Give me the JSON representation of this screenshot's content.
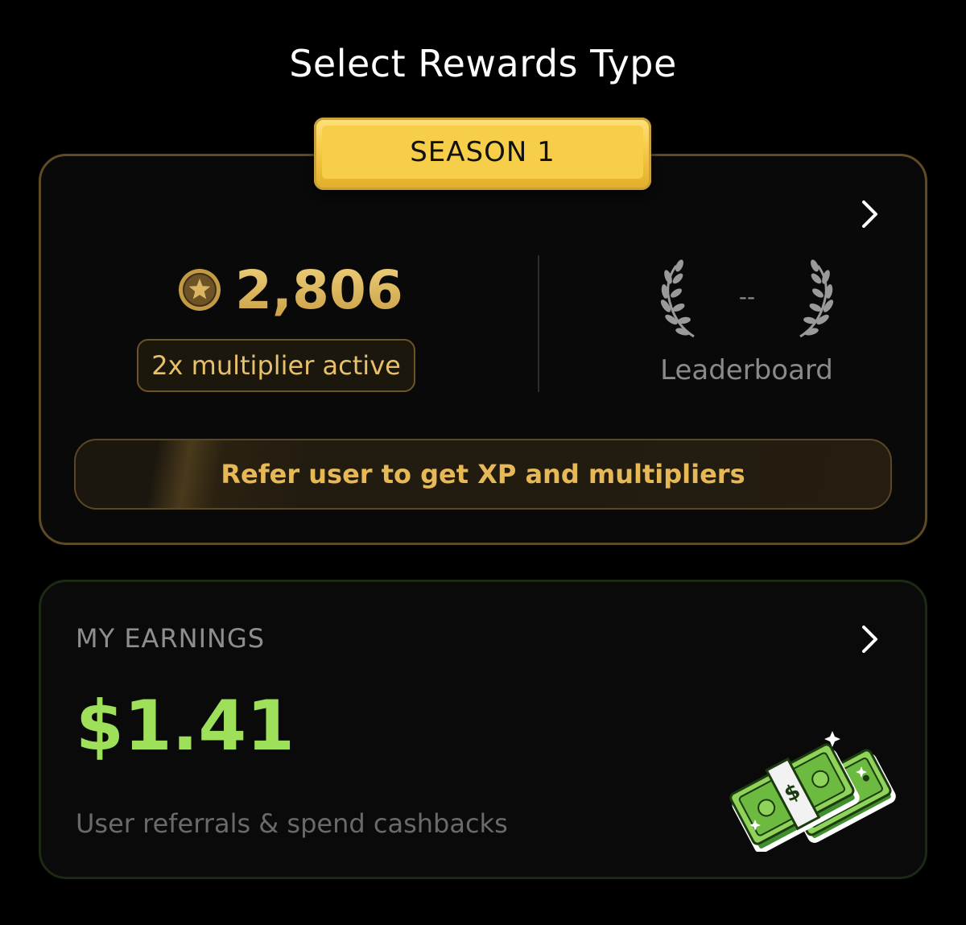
{
  "header": {
    "title": "Select Rewards Type"
  },
  "season_card": {
    "badge_label": "SEASON 1",
    "xp_value": "2,806",
    "multiplier_label": "2x multiplier active",
    "rank_value": "--",
    "leaderboard_label": "Leaderboard",
    "refer_button_label": "Refer user to get XP and multipliers"
  },
  "earnings_card": {
    "heading": "MY EARNINGS",
    "amount": "$1.41",
    "caption": "User referrals & spend cashbacks"
  },
  "colors": {
    "background": "#000000",
    "gold_accent": "#e6b856",
    "season_border": "#5e4a25",
    "earnings_green": "#9ee05a"
  },
  "icons": [
    "chevron-right-icon",
    "star-coin-icon",
    "laurel-left-icon",
    "laurel-right-icon",
    "cash-stack-icon"
  ]
}
